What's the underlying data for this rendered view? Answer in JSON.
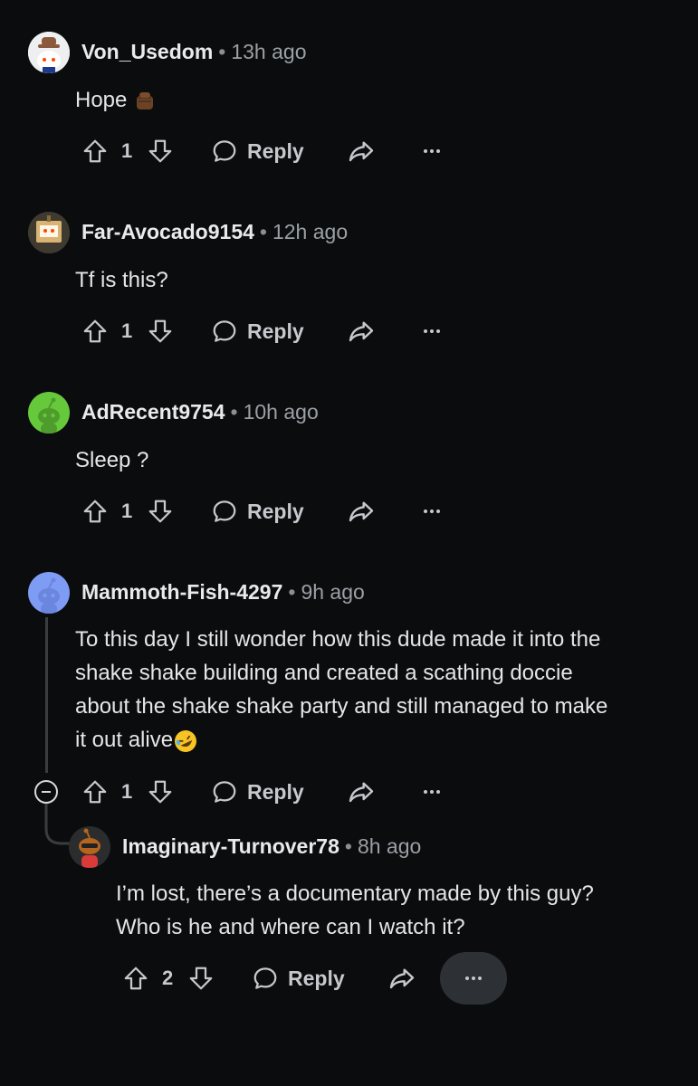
{
  "comments": [
    {
      "username": "Von_Usedom",
      "time": "13h ago",
      "text": "Hope",
      "emoji": "fist-emoji",
      "votes": "1",
      "reply_label": "Reply",
      "avatar": "cowboy-snoo"
    },
    {
      "username": "Far-Avocado9154",
      "time": "12h ago",
      "text": "Tf is this?",
      "votes": "1",
      "reply_label": "Reply",
      "avatar": "robot-snoo"
    },
    {
      "username": "AdRecent9754",
      "time": "10h ago",
      "text": "Sleep ?",
      "votes": "1",
      "reply_label": "Reply",
      "avatar": "green-snoo"
    },
    {
      "username": "Mammoth-Fish-4297",
      "time": "9h ago",
      "lines": [
        "To this day I still wonder how this dude made it into the",
        "shake shake building and created a scathing doccie",
        "about the shake shake party and still managed to make",
        "it out alive"
      ],
      "emoji": "rofl-emoji",
      "votes": "1",
      "reply_label": "Reply",
      "avatar": "blue-snoo"
    },
    {
      "username": "Imaginary-Turnover78",
      "time": "8h ago",
      "lines": [
        "I’m lost, there’s a documentary made by this guy?",
        "Who is he and where can I watch it?"
      ],
      "votes": "2",
      "reply_label": "Reply",
      "avatar": "red-snoo"
    }
  ],
  "separator": "•",
  "colors": {
    "background": "#0b0c0d",
    "text": "#d7dadc",
    "muted": "#9aa0a6",
    "pill": "#2d3135"
  }
}
